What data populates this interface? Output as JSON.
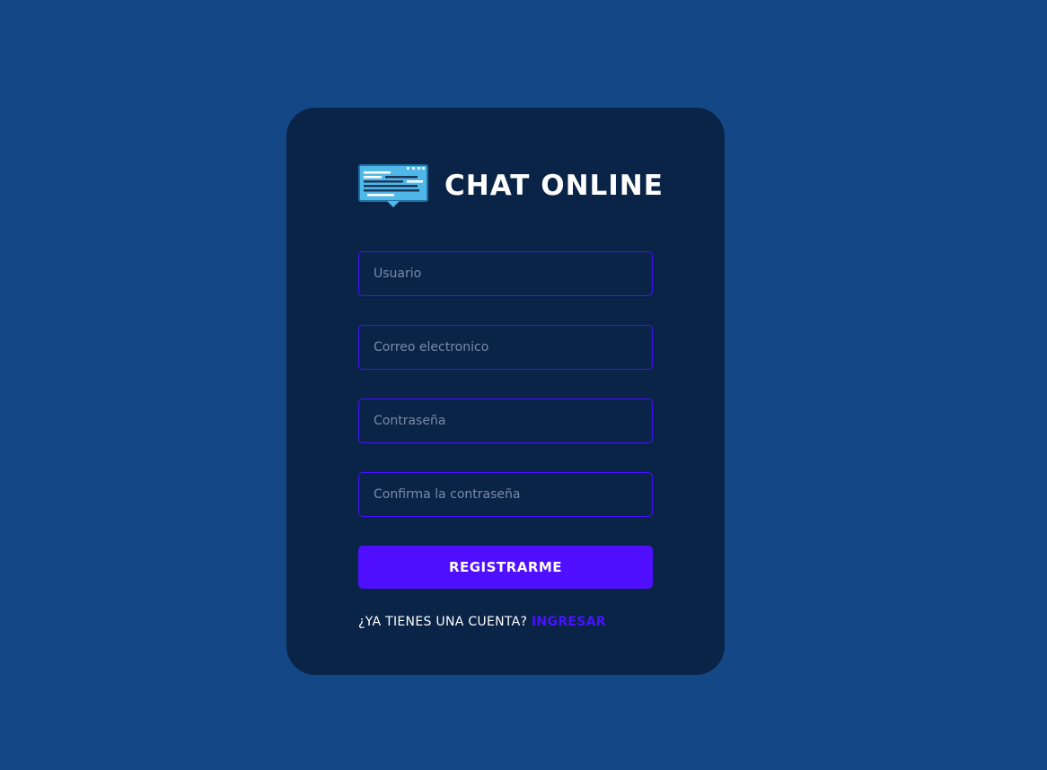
{
  "brand": {
    "title": "CHAT ONLINE",
    "logo_icon": "chat-screen-icon"
  },
  "form": {
    "username_placeholder": "Usuario",
    "email_placeholder": "Correo electronico",
    "password_placeholder": "Contraseña",
    "confirm_password_placeholder": "Confirma la contraseña",
    "submit_label": "REGISTRARME"
  },
  "footer": {
    "prompt": "¿YA TIENES UNA CUENTA?",
    "login_link": "INGRESAR"
  },
  "colors": {
    "page_background": "#144785",
    "card_background": "#0a2447",
    "accent": "#5010ff",
    "text": "#ffffff"
  }
}
